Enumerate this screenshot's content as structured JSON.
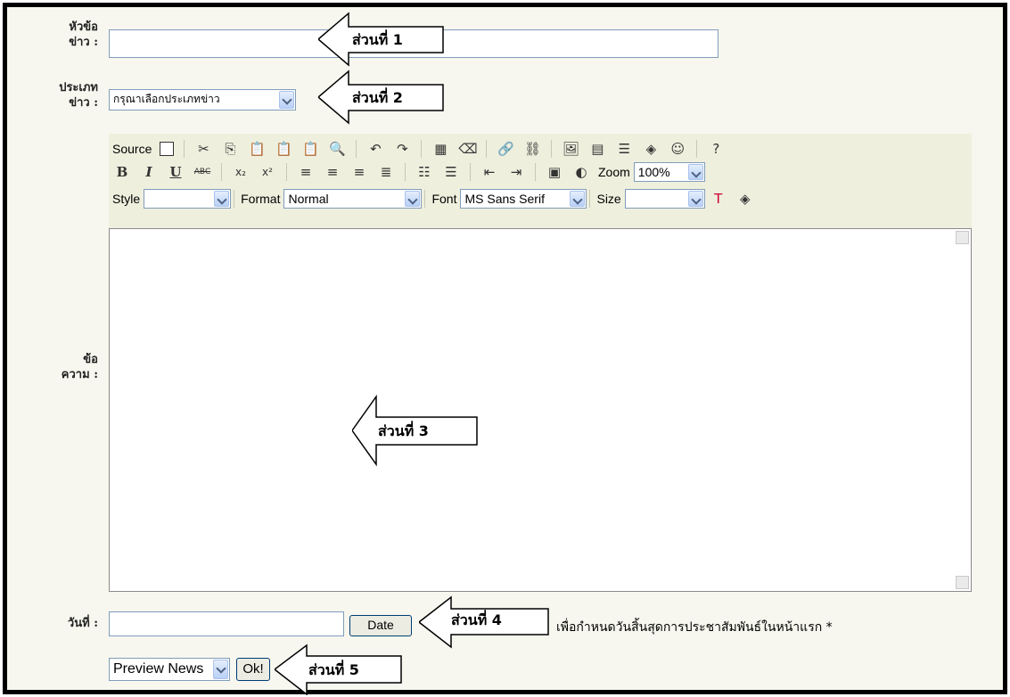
{
  "form": {
    "title_label_1": "หัวข้อ",
    "title_label_2": "ข่าว :",
    "type_label_1": "ประเภท",
    "type_label_2": "ข่าว :",
    "type_select": "กรุณาเลือกประเภทข่าว",
    "message_label_1": "ข้อ",
    "message_label_2": "ความ :",
    "date_label": "วันที่ :",
    "date_button": "Date",
    "date_note": "เพื่อกำหนดวันสิ้นสุดการประชาสัมพันธ์ในหน้าแรก *",
    "preview_select": "Preview News",
    "ok_button": "Ok!"
  },
  "toolbar": {
    "source_label": "Source",
    "zoom_label": "Zoom",
    "zoom_value": "100%",
    "style_label": "Style",
    "style_value": "",
    "format_label": "Format",
    "format_value": "Normal",
    "font_label": "Font",
    "font_value": "MS Sans Serif",
    "size_label": "Size",
    "size_value": "",
    "bold": "B",
    "italic": "I",
    "underline": "U",
    "strike": "ABC",
    "subscript": "x₂",
    "superscript": "x²"
  },
  "callouts": {
    "part1": "ส่วนที่ 1",
    "part2": "ส่วนที่ 2",
    "part3": "ส่วนที่ 3",
    "part4": "ส่วนที่ 4",
    "part5": "ส่วนที่ 5"
  }
}
